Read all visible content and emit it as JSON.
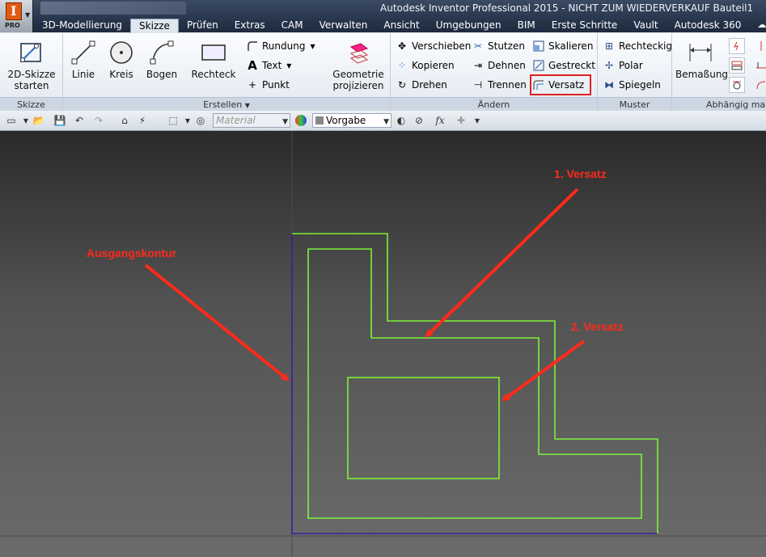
{
  "app": {
    "title": "Autodesk Inventor Professional 2015 - NICHT ZUM WIEDERVERKAUF   Bauteil1",
    "badge": "PRO"
  },
  "tabs": [
    {
      "label": "3D-Modellierung",
      "active": false
    },
    {
      "label": "Skizze",
      "active": true
    },
    {
      "label": "Prüfen",
      "active": false
    },
    {
      "label": "Extras",
      "active": false
    },
    {
      "label": "CAM",
      "active": false
    },
    {
      "label": "Verwalten",
      "active": false
    },
    {
      "label": "Ansicht",
      "active": false
    },
    {
      "label": "Umgebungen",
      "active": false
    },
    {
      "label": "BIM",
      "active": false
    },
    {
      "label": "Erste Schritte",
      "active": false
    },
    {
      "label": "Vault",
      "active": false
    },
    {
      "label": "Autodesk 360",
      "active": false
    }
  ],
  "ribbon": {
    "skizze": {
      "title": "Skizze",
      "start_label_1": "2D-Skizze",
      "start_label_2": "starten"
    },
    "erstellen": {
      "title": "Erstellen",
      "linie": "Linie",
      "kreis": "Kreis",
      "bogen": "Bogen",
      "rechteck": "Rechteck",
      "rundung": "Rundung",
      "text": "Text",
      "punkt": "Punkt",
      "geometrie_1": "Geometrie",
      "geometrie_2": "projizieren"
    },
    "aendern": {
      "title": "Ändern",
      "verschieben": "Verschieben",
      "kopieren": "Kopieren",
      "drehen": "Drehen",
      "stutzen": "Stutzen",
      "dehnen": "Dehnen",
      "trennen": "Trennen",
      "skalieren": "Skalieren",
      "gestreckt": "Gestreckt",
      "versatz": "Versatz"
    },
    "muster": {
      "title": "Muster",
      "rechteckig": "Rechteckig",
      "polar": "Polar",
      "spiegeln": "Spiegeln"
    },
    "abhaengig": {
      "title": "Abhängig ma",
      "bemassung": "Bemaßung"
    }
  },
  "toolbar": {
    "material_placeholder": "Material",
    "vorgabe": "Vorgabe"
  },
  "annotations": {
    "versatz1": "1. Versatz",
    "versatz2": "2. Versatz",
    "ausgang": "Ausgangskontur"
  },
  "colors": {
    "offset_line": "#7cf23a",
    "original_line": "#3a1fa0",
    "callout": "#ff2a1a",
    "highlight": "#e02020"
  }
}
